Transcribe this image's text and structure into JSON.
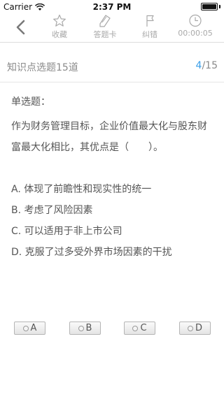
{
  "status_bar": {
    "carrier": "Carrier",
    "time": "2:37 PM"
  },
  "toolbar": {
    "favorite_label": "收藏",
    "answer_card_label": "答题卡",
    "correction_label": "纠错",
    "timer_value": "00:00:05"
  },
  "section": {
    "title": "知识点选题15道",
    "current": "4",
    "total": "/15"
  },
  "question": {
    "type": "单选题：",
    "text": "作为财务管理目标，企业价值最大化与股东财富最大化相比，其优点是（　　）。",
    "options": [
      "A. 体现了前瞻性和现实性的统一",
      "B. 考虑了风险因素",
      "C. 可以适用于非上市公司",
      "D. 克服了过多受外界市场因素的干扰"
    ]
  },
  "answer_buttons": [
    "A",
    "B",
    "C",
    "D"
  ],
  "colors": {
    "accent": "#3a9ee8",
    "toolbar_gray": "#a9a9a9",
    "text": "#555555"
  }
}
